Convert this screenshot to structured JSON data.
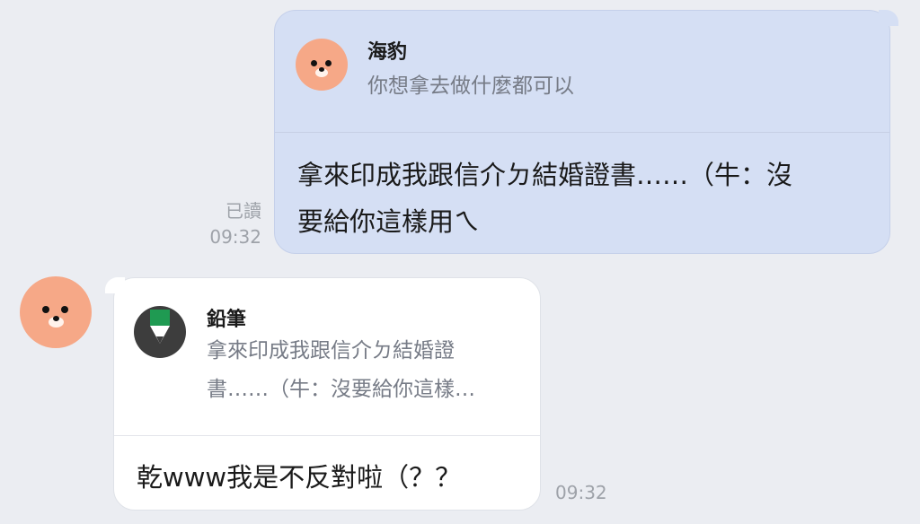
{
  "messages": [
    {
      "direction": "outgoing",
      "reply_to": {
        "sender": "海豹",
        "text": "你想拿去做什麼都可以",
        "avatar_icon": "seal-avatar-icon"
      },
      "text_lines": [
        "拿來印成我跟信介ㄉ結婚證書……（牛：沒",
        "要給你這樣用ㄟ"
      ],
      "read_status": "已讀",
      "time": "09:32"
    },
    {
      "direction": "incoming",
      "sender_avatar_icon": "seal-avatar-icon",
      "reply_to": {
        "sender": "鉛筆",
        "text_lines": [
          "拿來印成我跟信介ㄉ結婚證",
          "書……（牛：沒要給你這樣…"
        ],
        "avatar_icon": "pencil-avatar-icon"
      },
      "text": "乾www我是不反對啦（？？",
      "time": "09:32"
    }
  ],
  "colors": {
    "background": "#ebedf2",
    "outgoing_bubble": "#d5dff4",
    "incoming_bubble": "#ffffff",
    "seal_avatar": "#f6a887",
    "pencil_green": "#1f9a52"
  }
}
